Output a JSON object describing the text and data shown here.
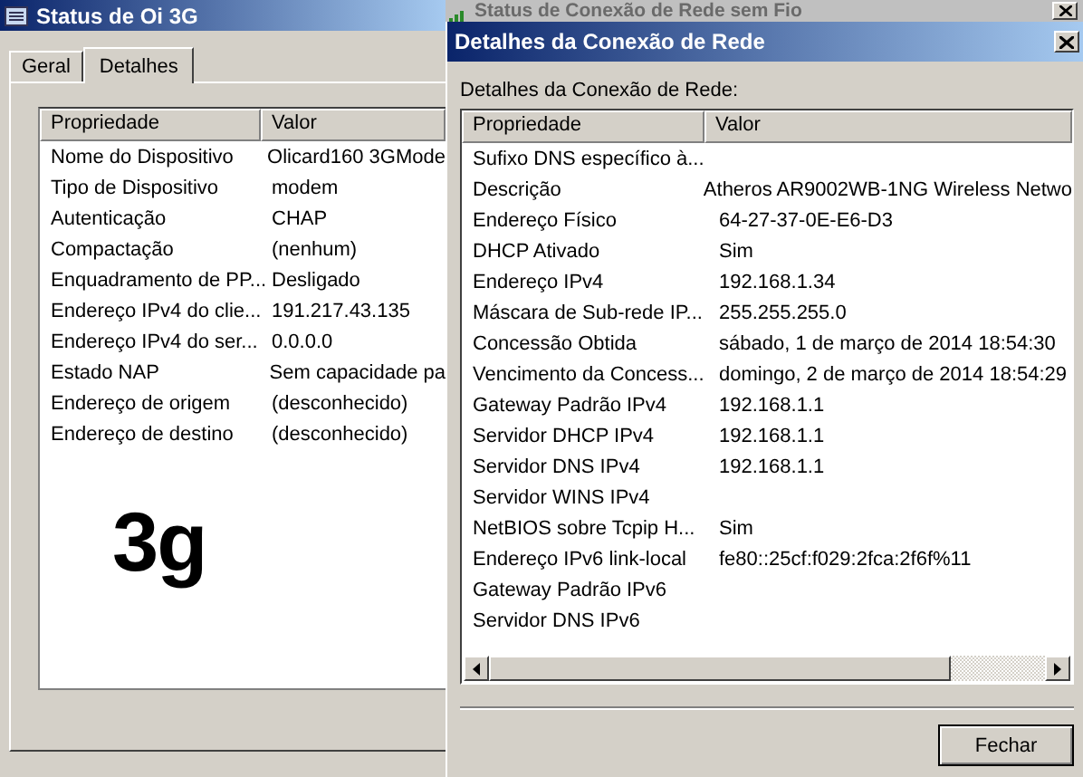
{
  "background_window": {
    "title": "Status de Conexão de Rede sem Fio"
  },
  "status_window": {
    "title": "Status de Oi 3G",
    "tabs": [
      {
        "label": "Geral",
        "selected": false
      },
      {
        "label": "Detalhes",
        "selected": true
      }
    ],
    "table": {
      "columns": [
        "Propriedade",
        "Valor"
      ],
      "rows": [
        [
          "Nome do Dispositivo",
          "Olicard160 3GMode"
        ],
        [
          "Tipo de Dispositivo",
          "modem"
        ],
        [
          "Autenticação",
          "CHAP"
        ],
        [
          "Compactação",
          "(nenhum)"
        ],
        [
          "Enquadramento de PP...",
          "Desligado"
        ],
        [
          "Endereço IPv4 do clie...",
          "191.217.43.135"
        ],
        [
          "Endereço IPv4 do ser...",
          "0.0.0.0"
        ],
        [
          "Estado NAP",
          "Sem capacidade pa"
        ],
        [
          "Endereço de origem",
          "(desconhecido)"
        ],
        [
          "Endereço de destino",
          "(desconhecido)"
        ]
      ]
    },
    "logo_text": "3g"
  },
  "details_dialog": {
    "title": "Detalhes da Conexão de Rede",
    "label": "Detalhes da Conexão de Rede:",
    "table": {
      "columns": [
        "Propriedade",
        "Valor"
      ],
      "rows": [
        [
          "Sufixo DNS específico à...",
          ""
        ],
        [
          "Descrição",
          "Atheros AR9002WB-1NG Wireless Netwo"
        ],
        [
          "Endereço Físico",
          "64-27-37-0E-E6-D3"
        ],
        [
          "DHCP Ativado",
          "Sim"
        ],
        [
          "Endereço IPv4",
          "192.168.1.34"
        ],
        [
          "Máscara de Sub-rede IP...",
          "255.255.255.0"
        ],
        [
          "Concessão Obtida",
          "sábado, 1 de março de 2014 18:54:30"
        ],
        [
          "Vencimento da Concess...",
          "domingo, 2 de março de 2014 18:54:29"
        ],
        [
          "Gateway Padrão IPv4",
          "192.168.1.1"
        ],
        [
          "Servidor DHCP IPv4",
          "192.168.1.1"
        ],
        [
          "Servidor DNS IPv4",
          "192.168.1.1"
        ],
        [
          "Servidor WINS IPv4",
          ""
        ],
        [
          "NetBIOS sobre Tcpip H...",
          "Sim"
        ],
        [
          "Endereço IPv6 link-local",
          "fe80::25cf:f029:2fca:2f6f%11"
        ],
        [
          "Gateway Padrão IPv6",
          ""
        ],
        [
          "Servidor DNS IPv6",
          ""
        ]
      ]
    },
    "buttons": [
      "Fechar"
    ]
  }
}
